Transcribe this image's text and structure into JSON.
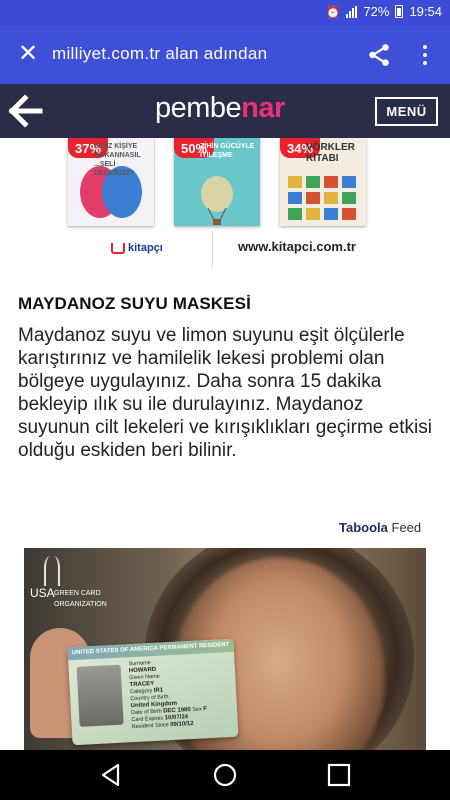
{
  "status_bar": {
    "battery": "72%",
    "time": "19:54"
  },
  "browser": {
    "url_text": "milliyet.com.tr alan adından"
  },
  "site_header": {
    "logo_main": "pembe",
    "logo_accent": "nar",
    "menu_label": "MENÜ"
  },
  "ad": {
    "books": [
      {
        "badge": "37%",
        "title": "BİNİZ KİŞİYE KOKANNASIL ...ŞELİ DEĞERSİZ?"
      },
      {
        "badge": "50%",
        "title": "ZİHİN GÜCÜYLE İYİLEŞME"
      },
      {
        "badge": "34%",
        "title": "VÖRKLER KİTABI"
      }
    ],
    "brand": "kitapçı",
    "site_url": "www.kitapci.com.tr"
  },
  "article": {
    "title": "MAYDANOZ SUYU MASKESİ",
    "body": "Maydanoz suyu ve limon suyunu eşit ölçülerle karıştırınız ve hamilelik lekesi problemi olan bölgeye uygulayınız. Daha sonra 15 dakika bekleyip ılık su ile durulayınız. Maydanoz suyunun cilt lekeleri ve kırışıklıkları geçirme etkisi olduğu eskiden beri bilinir."
  },
  "taboola": {
    "brand": "Taboola",
    "feed": "Feed"
  },
  "promo": {
    "org_line1": "USA",
    "org_line2": "GREEN CARD",
    "org_line3": "ORGANIZATION",
    "card_header": "UNITED STATES OF AMERICA  PERMANENT RESIDENT",
    "card_surname": "HOWARD",
    "card_given": "TRACEY",
    "card_country": "United Kingdom",
    "card_dob": "DEC 1980",
    "card_sex": "F",
    "card_category": "IR1",
    "card_expires": "10/07/24",
    "card_since": "09/10/12"
  },
  "icons": {
    "close": "close-icon",
    "share": "share-icon",
    "more": "more-vert-icon",
    "back": "arrow-left-icon"
  }
}
